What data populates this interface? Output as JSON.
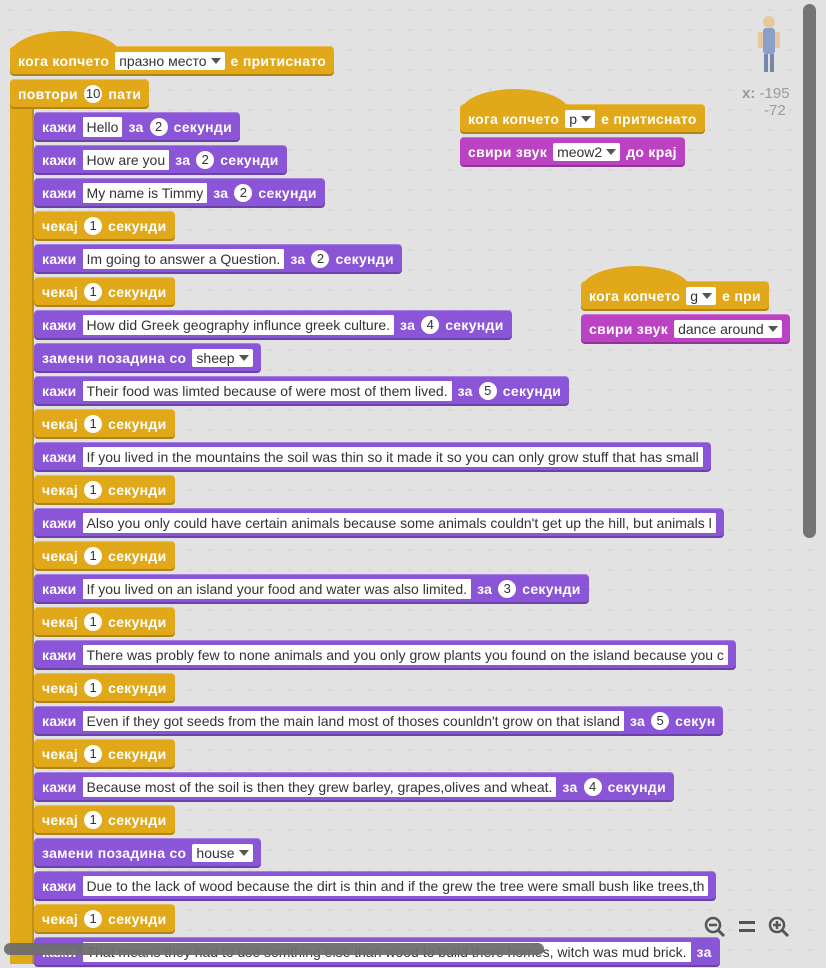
{
  "palette": {
    "looks": "#8a55d7",
    "control": "#e1a91a",
    "sound": "#bb42c3",
    "canvas": "#e2e2e2"
  },
  "sprite": {
    "x_label": "x:",
    "x_value": "-195",
    "y_value": "-72"
  },
  "script_main": {
    "hat": {
      "part1": "кога копчето",
      "key": "празно место",
      "part2": "е притиснато"
    },
    "repeat": {
      "label": "повтори",
      "count": "10",
      "suffix": "пати"
    },
    "blocks": [
      {
        "type": "say",
        "kw": "кажи",
        "text": "Hello",
        "for": "за",
        "secs": "2",
        "unit": "секунди"
      },
      {
        "type": "say",
        "kw": "кажи",
        "text": "How are you",
        "for": "за",
        "secs": "2",
        "unit": "секунди"
      },
      {
        "type": "say",
        "kw": "кажи",
        "text": "My name is Timmy",
        "for": "за",
        "secs": "2",
        "unit": "секунди"
      },
      {
        "type": "wait",
        "kw": "чекај",
        "secs": "1",
        "unit": "секунди"
      },
      {
        "type": "say",
        "kw": "кажи",
        "text": "Im going to answer a Question.",
        "for": "за",
        "secs": "2",
        "unit": "секунди"
      },
      {
        "type": "wait",
        "kw": "чекај",
        "secs": "1",
        "unit": "секунди"
      },
      {
        "type": "say",
        "kw": "кажи",
        "text": "How did Greek geography influnce greek culture.",
        "for": "за",
        "secs": "4",
        "unit": "секунди"
      },
      {
        "type": "backdrop",
        "kw": "замени позадина со",
        "value": "sheep"
      },
      {
        "type": "say",
        "kw": "кажи",
        "text": "Their food was limted because of were most of them lived.",
        "for": "за",
        "secs": "5",
        "unit": "секунди"
      },
      {
        "type": "wait",
        "kw": "чекај",
        "secs": "1",
        "unit": "секунди"
      },
      {
        "type": "say",
        "kw": "кажи",
        "text": "If you lived in the mountains the soil was thin so it made it so you can only grow stuff that has small",
        "for": "",
        "secs": "",
        "unit": ""
      },
      {
        "type": "wait",
        "kw": "чекај",
        "secs": "1",
        "unit": "секунди"
      },
      {
        "type": "say",
        "kw": "кажи",
        "text": "Also you only could have certain animals because some animals couldn't get up the hill, but animals l",
        "for": "",
        "secs": "",
        "unit": ""
      },
      {
        "type": "wait",
        "kw": "чекај",
        "secs": "1",
        "unit": "секунди"
      },
      {
        "type": "say",
        "kw": "кажи",
        "text": "If you lived on an island your food and water was also limited.",
        "for": "за",
        "secs": "3",
        "unit": "секунди"
      },
      {
        "type": "wait",
        "kw": "чекај",
        "secs": "1",
        "unit": "секунди"
      },
      {
        "type": "say",
        "kw": "кажи",
        "text": " There was probly few to none animals and you only grow plants you found on the island because you c",
        "for": "",
        "secs": "",
        "unit": ""
      },
      {
        "type": "wait",
        "kw": "чекај",
        "secs": "1",
        "unit": "секунди"
      },
      {
        "type": "say",
        "kw": "кажи",
        "text": "Even if they got seeds from the main land most of thoses counldn't grow on that island",
        "for": "за",
        "secs": "5",
        "unit": "секун"
      },
      {
        "type": "wait",
        "kw": "чекај",
        "secs": "1",
        "unit": "секунди"
      },
      {
        "type": "say",
        "kw": "кажи",
        "text": "  Because most of the soil is then they grew  barley, grapes,olives and wheat.",
        "for": "за",
        "secs": "4",
        "unit": "секунди"
      },
      {
        "type": "wait",
        "kw": "чекај",
        "secs": "1",
        "unit": "секунди"
      },
      {
        "type": "backdrop",
        "kw": "замени позадина со",
        "value": "house"
      },
      {
        "type": "say",
        "kw": "кажи",
        "text": "  Due to the lack of wood because the dirt is thin and if the grew the tree were small bush like trees,th",
        "for": "",
        "secs": "",
        "unit": ""
      },
      {
        "type": "wait",
        "kw": "чекај",
        "secs": "1",
        "unit": "секунди"
      },
      {
        "type": "say",
        "kw": "кажи",
        "text": "That means they had to use somthing else than wood to build there homes, witch was mud brick.",
        "for": "за",
        "secs": "",
        "unit": ""
      }
    ]
  },
  "script_p": {
    "hat": {
      "part1": "кога копчето",
      "key": "p",
      "part2": "е притиснато"
    },
    "sound": {
      "kw": "свири звук",
      "value": "meow2",
      "suffix": "до крај"
    }
  },
  "script_g": {
    "hat": {
      "part1": "кога копчето",
      "key": "g",
      "part2": "е при"
    },
    "sound": {
      "kw": "свири звук",
      "value": "dance around"
    }
  },
  "zoom": {
    "out": "zoom-out-icon",
    "reset": "zoom-reset-icon",
    "in": "zoom-in-icon"
  }
}
